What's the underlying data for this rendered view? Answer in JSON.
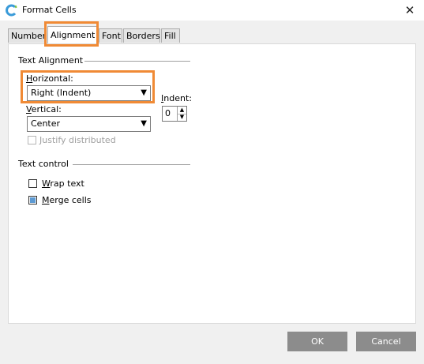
{
  "window": {
    "title": "Format Cells",
    "close_symbol": "✕"
  },
  "tabs": [
    {
      "label": "Number",
      "active": false
    },
    {
      "label": "Alignment",
      "active": true
    },
    {
      "label": "Font",
      "active": false
    },
    {
      "label": "Borders",
      "active": false
    },
    {
      "label": "Fill",
      "active": false
    }
  ],
  "text_alignment": {
    "heading": "Text Alignment",
    "horizontal": {
      "label_accel": "H",
      "label_rest": "orizontal:",
      "value": "Right (Indent)"
    },
    "vertical": {
      "label_accel": "V",
      "label_rest": "ertical:",
      "value": "Center"
    },
    "indent": {
      "label_accel": "I",
      "label_rest": "ndent:",
      "value": "0"
    },
    "justify_distributed": {
      "label": "Justify distributed",
      "checked": false,
      "enabled": false
    }
  },
  "text_control": {
    "heading": "Text control",
    "wrap_text": {
      "label_accel": "W",
      "label_rest": "rap text",
      "checked": false
    },
    "merge_cells": {
      "label_accel": "M",
      "label_rest": "erge cells",
      "checked": true
    }
  },
  "buttons": {
    "ok": "OK",
    "cancel": "Cancel"
  },
  "icons": {
    "dropdown_arrow": "▼",
    "spin_up": "▲",
    "spin_down": "▼"
  },
  "colors": {
    "highlight": "#f08a35",
    "checked_fill": "#5d9ad3",
    "button_bg": "#8c8c8c"
  }
}
